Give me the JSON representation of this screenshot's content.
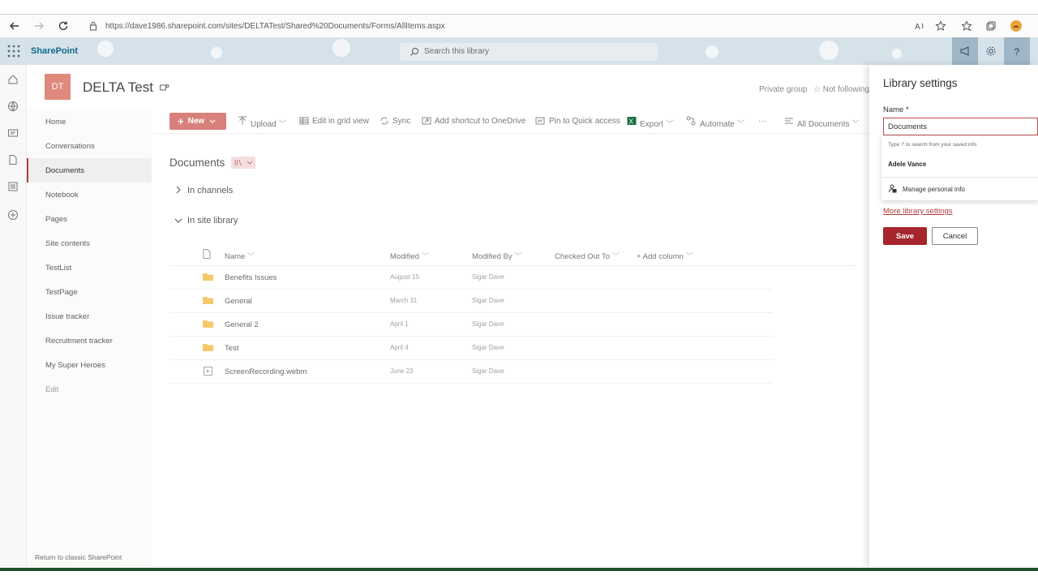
{
  "browser": {
    "url": "https://dave1986.sharepoint.com/sites/DELTATest/Shared%20Documents/Forms/AllItems.aspx"
  },
  "suite": {
    "brand": "SharePoint",
    "search_placeholder": "Search this library"
  },
  "site": {
    "logo_initials": "DT",
    "title": "DELTA Test",
    "privacy": "Private group",
    "follow": "Not following"
  },
  "nav": {
    "items": [
      "Home",
      "Conversations",
      "Documents",
      "Notebook",
      "Pages",
      "Site contents",
      "TestList",
      "TestPage",
      "Issue tracker",
      "Recruitment tracker",
      "My Super Heroes",
      "Edit"
    ],
    "active": "Documents",
    "classic_link": "Return to classic SharePoint"
  },
  "commands": {
    "new": "New",
    "upload": "Upload",
    "grid": "Edit in grid view",
    "sync": "Sync",
    "shortcut": "Add shortcut to OneDrive",
    "pin": "Pin to Quick access",
    "export": "Export",
    "automate": "Automate",
    "more": "···",
    "view": "All Documents"
  },
  "library": {
    "heading": "Documents",
    "section_channels": "In channels",
    "section_site": "In site library",
    "columns": {
      "name": "Name",
      "modified": "Modified",
      "modified_by": "Modified By",
      "checked_out": "Checked Out To",
      "add": "Add column"
    },
    "rows": [
      {
        "name": "Benefits Issues",
        "modified": "August 15",
        "by": "Sigar Dave",
        "type": "folder"
      },
      {
        "name": "General",
        "modified": "March 31",
        "by": "Sigar Dave",
        "type": "folder"
      },
      {
        "name": "General 2",
        "modified": "April 1",
        "by": "Sigar Dave",
        "type": "folder"
      },
      {
        "name": "Test",
        "modified": "April 4",
        "by": "Sigar Dave",
        "type": "folder"
      },
      {
        "name": "ScreenRecording.webm",
        "modified": "June 23",
        "by": "Sigar Dave",
        "type": "video"
      }
    ]
  },
  "panel": {
    "title": "Library settings",
    "name_label": "Name *",
    "name_value": "Documents",
    "autofill_hint": "Type '/' to search from your saved info",
    "autofill_person": "Adele Vance",
    "autofill_manage": "Manage personal info",
    "more_link": "More library settings",
    "save": "Save",
    "cancel": "Cancel"
  },
  "colors": {
    "accent": "#a4262c",
    "new_button": "#d8807c",
    "logo": "#e0897d"
  }
}
